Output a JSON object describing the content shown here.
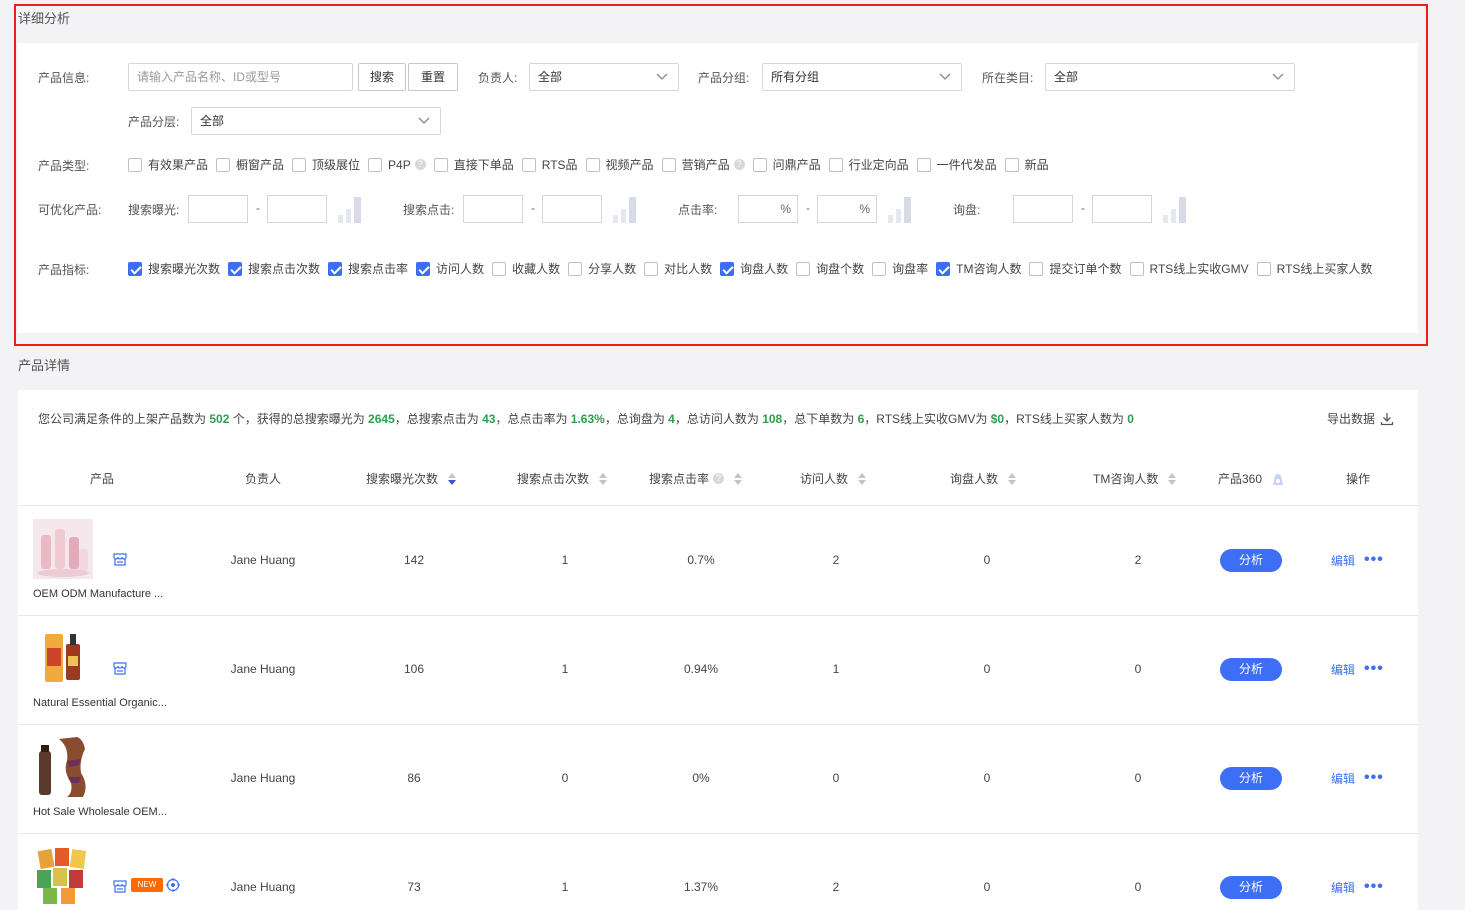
{
  "detail_section": {
    "title": "详细分析"
  },
  "filters": {
    "product_info": {
      "label": "产品信息:",
      "placeholder": "请输入产品名称、ID或型号",
      "search_btn": "搜索",
      "reset_btn": "重置"
    },
    "owner": {
      "label": "负责人:",
      "value": "全部"
    },
    "product_group": {
      "label": "产品分组:",
      "value": "所有分组"
    },
    "category": {
      "label": "所在类目:",
      "value": "全部"
    },
    "product_tier": {
      "label": "产品分层:",
      "value": "全部"
    },
    "product_type": {
      "label": "产品类型:",
      "options": [
        {
          "label": "有效果产品",
          "checked": false
        },
        {
          "label": "橱窗产品",
          "checked": false
        },
        {
          "label": "顶级展位",
          "checked": false
        },
        {
          "label": "P4P",
          "checked": false,
          "help": true
        },
        {
          "label": "直接下单品",
          "checked": false
        },
        {
          "label": "RTS品",
          "checked": false
        },
        {
          "label": "视频产品",
          "checked": false
        },
        {
          "label": "营销产品",
          "checked": false,
          "help": true
        },
        {
          "label": "问鼎产品",
          "checked": false
        },
        {
          "label": "行业定向品",
          "checked": false
        },
        {
          "label": "一件代发品",
          "checked": false
        },
        {
          "label": "新品",
          "checked": false
        }
      ]
    },
    "optimizable": {
      "label": "可优化产品:",
      "search_exposure": "搜索曝光:",
      "search_click": "搜索点击:",
      "ctr": "点击率:",
      "inquiry": "询盘:",
      "percent": "%",
      "dash": "-"
    },
    "metrics": {
      "label": "产品指标:",
      "options": [
        {
          "label": "搜索曝光次数",
          "checked": true
        },
        {
          "label": "搜索点击次数",
          "checked": true
        },
        {
          "label": "搜索点击率",
          "checked": true
        },
        {
          "label": "访问人数",
          "checked": true
        },
        {
          "label": "收藏人数",
          "checked": false
        },
        {
          "label": "分享人数",
          "checked": false
        },
        {
          "label": "对比人数",
          "checked": false
        },
        {
          "label": "询盘人数",
          "checked": true
        },
        {
          "label": "询盘个数",
          "checked": false
        },
        {
          "label": "询盘率",
          "checked": false
        },
        {
          "label": "TM咨询人数",
          "checked": true
        },
        {
          "label": "提交订单个数",
          "checked": false
        },
        {
          "label": "RTS线上实收GMV",
          "checked": false
        },
        {
          "label": "RTS线上买家人数",
          "checked": false
        }
      ]
    }
  },
  "product_section": {
    "title": "产品详情"
  },
  "summary": {
    "t1": "您公司满足条件的上架产品数为 ",
    "v1": "502",
    "t2": " 个，获得的总搜索曝光为 ",
    "v2": "2645",
    "t3": "，总搜索点击为 ",
    "v3": "43",
    "t4": "，总点击率为 ",
    "v4": "1.63%",
    "t5": "，总询盘为 ",
    "v5": "4",
    "t6": "，总访问人数为 ",
    "v6": "108",
    "t7": "，总下单数为 ",
    "v7": "6",
    "t8": "，RTS线上实收GMV为 ",
    "v8": "$0",
    "t9": "，RTS线上买家人数为 ",
    "v9": "0",
    "export": "导出数据"
  },
  "table": {
    "headers": {
      "product": "产品",
      "owner": "负责人",
      "exposure": "搜索曝光次数",
      "clicks": "搜索点击次数",
      "ctr": "搜索点击率",
      "visitors": "访问人数",
      "inquirers": "询盘人数",
      "tm": "TM咨询人数",
      "p360": "产品360",
      "action": "操作"
    },
    "rows": [
      {
        "name": "OEM ODM Manufacture ...",
        "owner": "Jane Huang",
        "exposure": "142",
        "clicks": "1",
        "ctr": "0.7%",
        "visitors": "2",
        "inquirers": "0",
        "tm": "2",
        "analyze": "分析",
        "edit": "编辑",
        "more": "•••",
        "badge": ""
      },
      {
        "name": "Natural Essential Organic...",
        "owner": "Jane Huang",
        "exposure": "106",
        "clicks": "1",
        "ctr": "0.94%",
        "visitors": "1",
        "inquirers": "0",
        "tm": "0",
        "analyze": "分析",
        "edit": "编辑",
        "more": "•••",
        "badge": ""
      },
      {
        "name": "Hot Sale Wholesale OEM...",
        "owner": "Jane Huang",
        "exposure": "86",
        "clicks": "0",
        "ctr": "0%",
        "visitors": "0",
        "inquirers": "0",
        "tm": "0",
        "analyze": "分析",
        "edit": "编辑",
        "more": "•••",
        "badge": ""
      },
      {
        "name": "",
        "owner": "Jane Huang",
        "exposure": "73",
        "clicks": "1",
        "ctr": "1.37%",
        "visitors": "2",
        "inquirers": "0",
        "tm": "0",
        "analyze": "分析",
        "edit": "编辑",
        "more": "•••",
        "badge": "NEW"
      }
    ]
  }
}
